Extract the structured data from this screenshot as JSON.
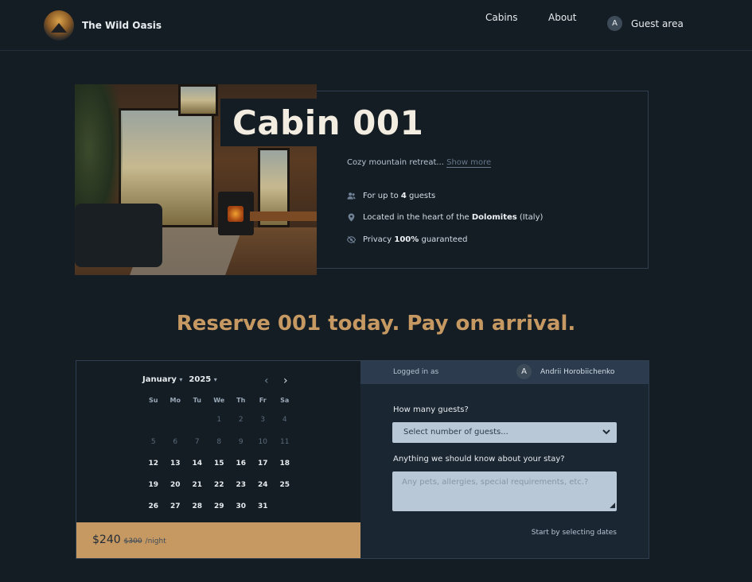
{
  "header": {
    "brand": "The Wild Oasis",
    "nav": {
      "cabins": "Cabins",
      "about": "About",
      "guest_area": "Guest area",
      "avatar_initial": "A"
    }
  },
  "cabin": {
    "title": "Cabin 001",
    "description": "Cozy mountain retreat...",
    "show_more": "Show more",
    "features": [
      {
        "icon": "users-icon",
        "prefix": "For up to ",
        "bold": "4",
        "suffix": " guests"
      },
      {
        "icon": "map-pin-icon",
        "prefix": "Located in the heart of the ",
        "bold": "Dolomites",
        "suffix": " (Italy)"
      },
      {
        "icon": "eye-slash-icon",
        "prefix": "Privacy ",
        "bold": "100%",
        "suffix": " guaranteed"
      }
    ]
  },
  "reserve": {
    "heading": "Reserve 001 today. Pay on arrival.",
    "calendar": {
      "month": "January",
      "year": "2025",
      "weekdays": [
        "Su",
        "Mo",
        "Tu",
        "We",
        "Th",
        "Fr",
        "Sa"
      ],
      "weeks": [
        [
          "",
          "",
          "",
          "1",
          "2",
          "3",
          "4"
        ],
        [
          "5",
          "6",
          "7",
          "8",
          "9",
          "10",
          "11"
        ],
        [
          "12",
          "13",
          "14",
          "15",
          "16",
          "17",
          "18"
        ],
        [
          "19",
          "20",
          "21",
          "22",
          "23",
          "24",
          "25"
        ],
        [
          "26",
          "27",
          "28",
          "29",
          "30",
          "31",
          ""
        ]
      ],
      "past_days_through": 11
    },
    "price": {
      "current": "$240",
      "original": "$300",
      "unit": "/night"
    },
    "login": {
      "label": "Logged in as",
      "avatar_initial": "A",
      "user": "Andrii Horobiichenko"
    },
    "form": {
      "guests_label": "How many guests?",
      "guests_placeholder": "Select number of guests...",
      "notes_label": "Anything we should know about your stay?",
      "notes_placeholder": "Any pets, allergies, special requirements, etc.?",
      "hint": "Start by selecting dates"
    }
  },
  "colors": {
    "background": "#141c24",
    "accent": "#c69963",
    "panel": "#1b2633",
    "input": "#b9c8d6"
  }
}
